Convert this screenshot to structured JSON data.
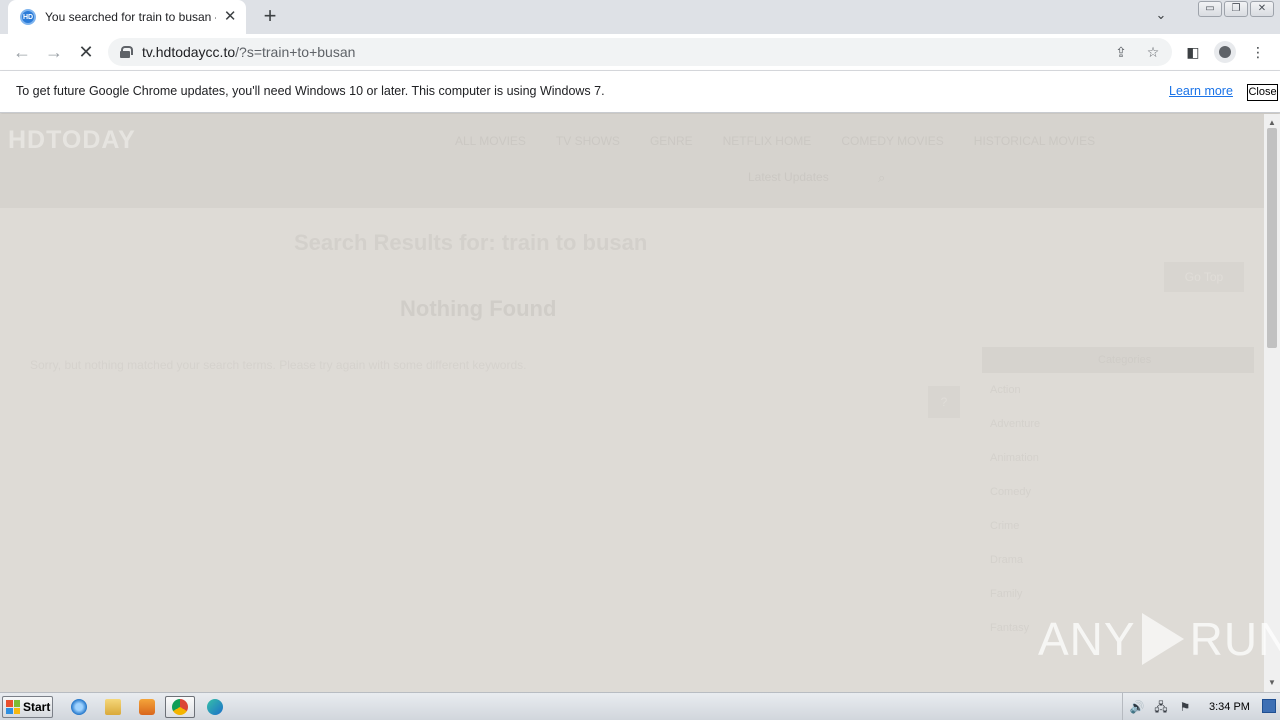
{
  "browser": {
    "tab": {
      "favicon_text": "HD",
      "title": "You searched for train to busan - HDToday",
      "close_glyph": "✕"
    },
    "new_tab_glyph": "+",
    "tab_search_glyph": "⌄",
    "window_buttons": [
      "▭",
      "❐",
      "✕"
    ],
    "toolbar": {
      "back_glyph": "←",
      "forward_glyph": "→",
      "stop_glyph": "✕",
      "url_host": "tv.hdtodaycc.to",
      "url_path": "/?s=train+to+busan",
      "share_glyph": "⇪",
      "bookmark_glyph": "☆",
      "sidepanel_glyph": "◧",
      "menu_glyph": "⋮"
    }
  },
  "infobar": {
    "message": "To get future Google Chrome updates, you'll need Windows 10 or later. This computer is using Windows 7.",
    "learn_more": "Learn more",
    "close": "Close"
  },
  "page": {
    "logo": "HDTODAY",
    "menu": [
      "ALL MOVIES",
      "TV SHOWS",
      "GENRE",
      "NETFLIX HOME",
      "COMEDY MOVIES",
      "HISTORICAL MOVIES"
    ],
    "menu_second_row": "Latest Updates",
    "search_glyph": "⌕",
    "results_title": "Search Results for: train to busan",
    "nothing_found": "Nothing Found",
    "sorry_text": "Sorry, but nothing matched your search terms. Please try again with some different keywords.",
    "top_button": "Go Top",
    "side_search_label": "Categories",
    "side_q_button": "?",
    "side_list": [
      "Action",
      "Adventure",
      "Animation",
      "Comedy",
      "Crime",
      "Drama",
      "Family",
      "Fantasy"
    ]
  },
  "scrollbar": {
    "up": "▲",
    "down": "▼"
  },
  "watermark": {
    "left": "ANY",
    "right": "RUN"
  },
  "taskbar": {
    "start_label": "Start",
    "clock": "3:34 PM",
    "tray_icons": [
      "speaker-icon",
      "network-icon",
      "flag-icon"
    ],
    "tray_glyphs": [
      "🔊",
      "🖧",
      "⚑"
    ]
  },
  "colors": {
    "tab_strip": "#dee1e6",
    "page_bg": "#dedbd6",
    "link": "#1a73e8",
    "favicon": "#2b7bd8"
  }
}
